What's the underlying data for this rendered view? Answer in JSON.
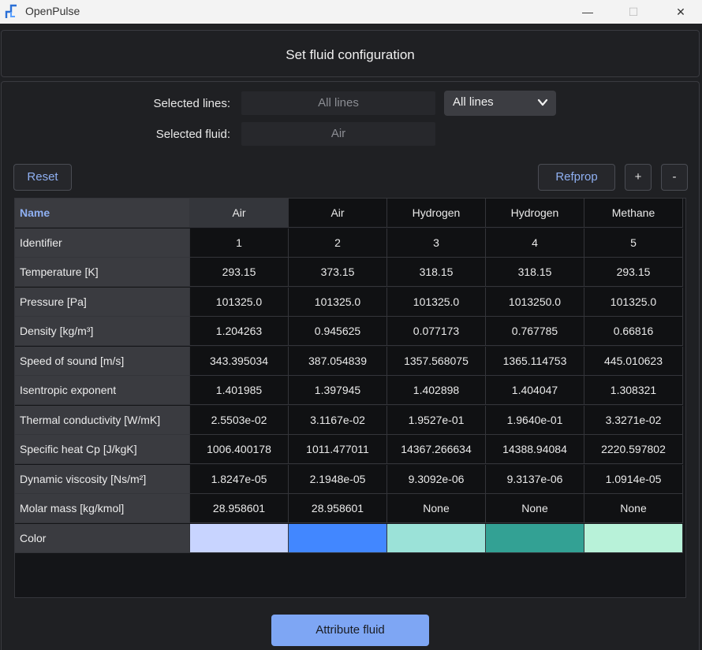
{
  "window": {
    "app_title": "OpenPulse",
    "minimize": "—",
    "maximize": "☐",
    "close": "✕"
  },
  "header": {
    "title": "Set fluid configuration"
  },
  "form": {
    "selected_lines_label": "Selected lines:",
    "selected_lines_value": "All lines",
    "lines_dropdown_value": "All lines",
    "selected_fluid_label": "Selected fluid:",
    "selected_fluid_value": "Air"
  },
  "toolbar": {
    "reset": "Reset",
    "refprop": "Refprop",
    "add": "+",
    "remove": "-"
  },
  "table": {
    "name_header": "Name",
    "columns": [
      "Air",
      "Air",
      "Hydrogen",
      "Hydrogen",
      "Methane"
    ],
    "rows": [
      {
        "label": "Identifier",
        "values": [
          "1",
          "2",
          "3",
          "4",
          "5"
        ]
      },
      {
        "label": "Temperature [K]",
        "values": [
          "293.15",
          "373.15",
          "318.15",
          "318.15",
          "293.15"
        ]
      },
      {
        "label": "Pressure [Pa]",
        "values": [
          "101325.0",
          "101325.0",
          "101325.0",
          "1013250.0",
          "101325.0"
        ]
      },
      {
        "label": "Density [kg/m³]",
        "values": [
          "1.204263",
          "0.945625",
          "0.077173",
          "0.767785",
          "0.66816"
        ]
      },
      {
        "label": "Speed of sound [m/s]",
        "values": [
          "343.395034",
          "387.054839",
          "1357.568075",
          "1365.114753",
          "445.010623"
        ]
      },
      {
        "label": "Isentropic exponent",
        "values": [
          "1.401985",
          "1.397945",
          "1.402898",
          "1.404047",
          "1.308321"
        ]
      },
      {
        "label": "Thermal conductivity [W/mK]",
        "values": [
          "2.5503e-02",
          "3.1167e-02",
          "1.9527e-01",
          "1.9640e-01",
          "3.3271e-02"
        ]
      },
      {
        "label": "Specific heat Cp [J/kgK]",
        "values": [
          "1006.400178",
          "1011.477011",
          "14367.266634",
          "14388.94084",
          "2220.597802"
        ]
      },
      {
        "label": "Dynamic viscosity [Ns/m²]",
        "values": [
          "1.8247e-05",
          "2.1948e-05",
          "9.3092e-06",
          "9.3137e-06",
          "1.0914e-05"
        ]
      },
      {
        "label": "Molar mass [kg/kmol]",
        "values": [
          "28.958601",
          "28.958601",
          "None",
          "None",
          "None"
        ]
      }
    ],
    "color_label": "Color",
    "colors": [
      "#c8d4ff",
      "#4287ff",
      "#9be2d8",
      "#33a194",
      "#b8f2d9"
    ]
  },
  "footer": {
    "attribute_button": "Attribute fluid"
  }
}
